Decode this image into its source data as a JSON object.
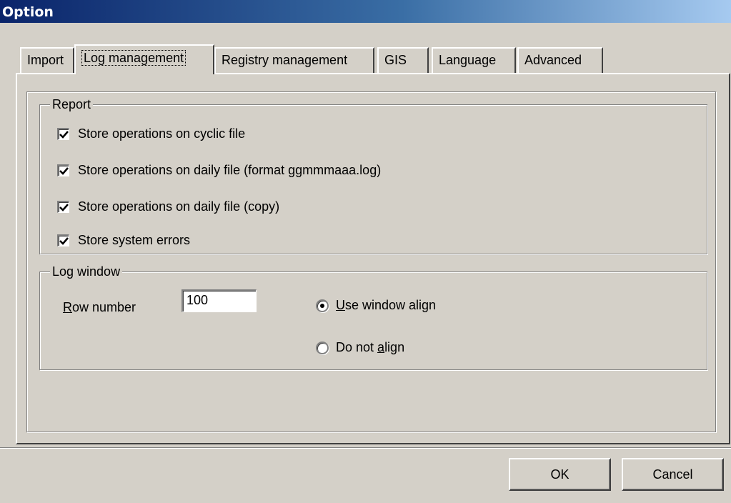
{
  "window": {
    "title": "Option"
  },
  "tabs": [
    {
      "label": "Import"
    },
    {
      "label": "Log management"
    },
    {
      "label": "Registry management"
    },
    {
      "label": "GIS"
    },
    {
      "label": "Language"
    },
    {
      "label": "Advanced"
    }
  ],
  "active_tab": "Log management",
  "report": {
    "legend": "Report",
    "items": [
      {
        "label": "Store operations on cyclic file",
        "checked": true
      },
      {
        "label": "Store operations on daily file (format ggmmmaaa.log)",
        "checked": true
      },
      {
        "label": "Store operations on daily file (copy)",
        "checked": true
      },
      {
        "label": "Store system errors",
        "checked": true
      }
    ]
  },
  "log_window": {
    "legend": "Log window",
    "row_number_label_first": "R",
    "row_number_label_rest": "ow number",
    "row_number_value": "100",
    "radio_use_u": "U",
    "radio_use_rest": "se window align",
    "radio_dont_pre": "Do not ",
    "radio_dont_u": "a",
    "radio_dont_post": "lign",
    "selected": "use_window_align"
  },
  "buttons": {
    "ok": "OK",
    "cancel": "Cancel"
  },
  "icons": {
    "checkmark": "check-icon",
    "radio_dot": "radio-dot-icon"
  }
}
